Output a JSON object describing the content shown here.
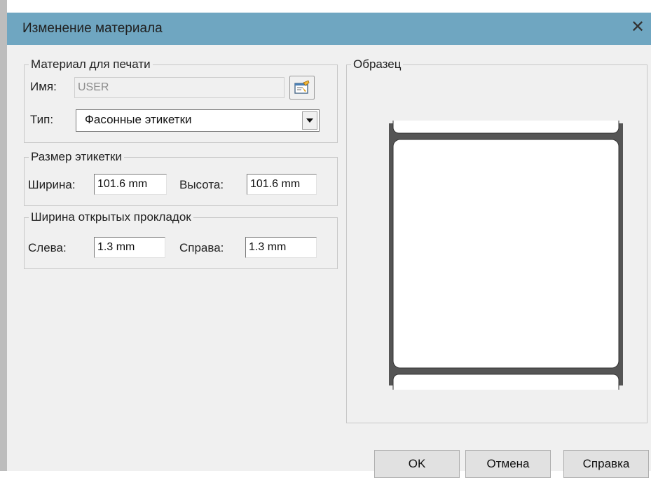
{
  "window": {
    "title": "Изменение материала",
    "close_glyph": "✕"
  },
  "material": {
    "legend": "Материал для печати",
    "name_label": "Имя:",
    "name_value": "USER",
    "properties_icon": "properties-icon",
    "type_label": "Тип:",
    "type_value": "Фасонные этикетки",
    "dropdown_icon": "chevron-down-icon"
  },
  "label_size": {
    "legend": "Размер этикетки",
    "width_label": "Ширина:",
    "width_value": "101.6 mm",
    "height_label": "Высота:",
    "height_value": "101.6 mm"
  },
  "liner": {
    "legend": "Ширина открытых прокладок",
    "left_label": "Слева:",
    "left_value": "1.3 mm",
    "right_label": "Справа:",
    "right_value": "1.3 mm"
  },
  "sample": {
    "legend": "Образец"
  },
  "buttons": {
    "ok": "OK",
    "cancel": "Отмена",
    "help": "Справка"
  },
  "colors": {
    "titlebar": "#6fa6c1",
    "dialog_bg": "#f0f0f0",
    "liner": "#555555",
    "label": "#ffffff"
  }
}
